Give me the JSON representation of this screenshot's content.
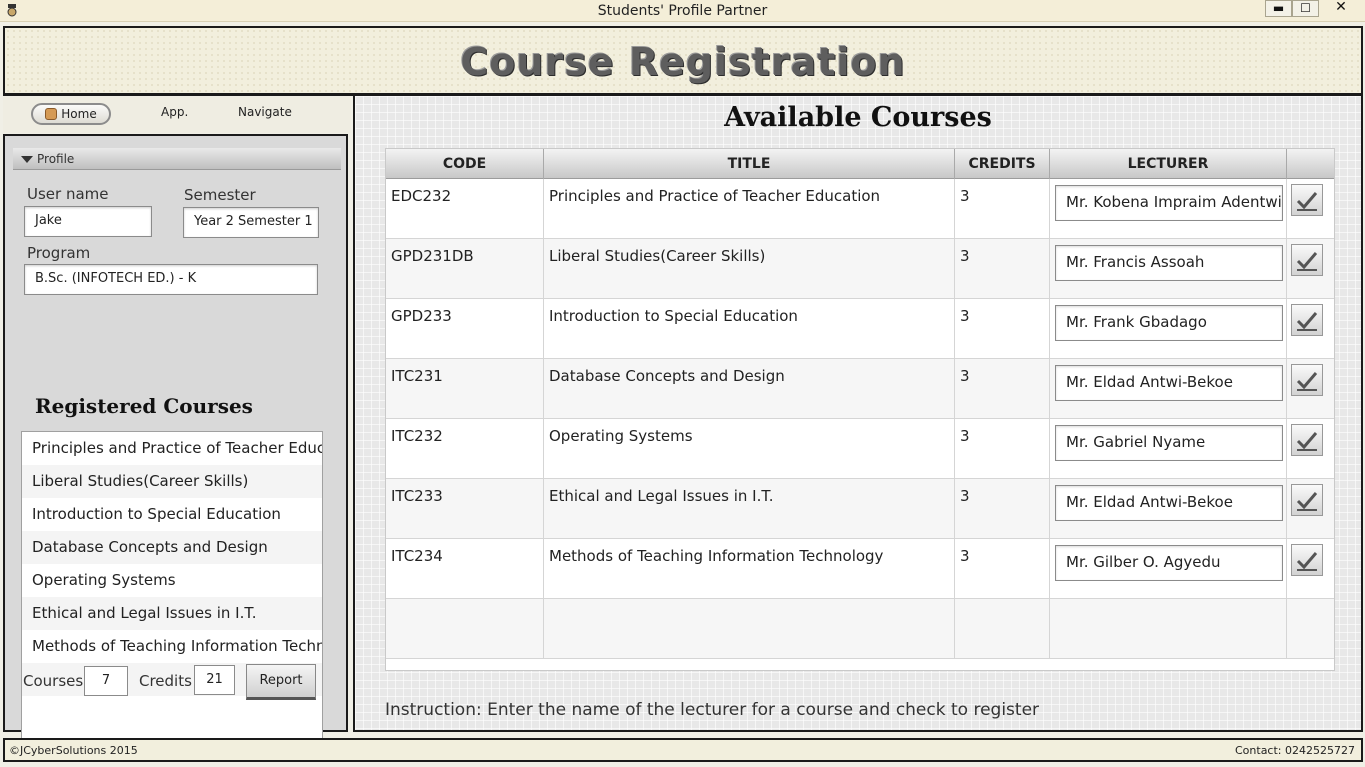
{
  "window": {
    "title": "Students' Profile Partner",
    "min": "▬",
    "max": "☐",
    "close": "✕"
  },
  "header": {
    "title": "Course Registration"
  },
  "nav": {
    "home": "Home",
    "app": "App.",
    "navigate": "Navigate"
  },
  "profile": {
    "section_label": "Profile",
    "username_label": "User name",
    "username": "Jake",
    "semester_label": "Semester",
    "semester": "Year 2 Semester 1",
    "program_label": "Program",
    "program": "B.Sc. (INFOTECH ED.) - K",
    "registered_title": "Registered Courses",
    "registered": [
      "Principles and Practice of Teacher Education",
      "Liberal Studies(Career Skills)",
      "Introduction to Special Education",
      "Database Concepts and Design",
      "Operating Systems",
      "Ethical and Legal Issues in I.T.",
      "Methods of Teaching Information Technology",
      ""
    ],
    "courses_label": "Courses",
    "courses": "7",
    "credits_label": "Credits",
    "credits": "21",
    "report_label": "Report"
  },
  "available": {
    "title": "Available Courses",
    "columns": {
      "code": "CODE",
      "title": "TITLE",
      "credits": "CREDITS",
      "lecturer": "LECTURER"
    },
    "rows": [
      {
        "code": "EDC232",
        "title": "Principles and Practice of Teacher Education",
        "credits": "3",
        "lecturer": "Mr. Kobena Impraim Adentwi"
      },
      {
        "code": "GPD231DB",
        "title": "Liberal Studies(Career Skills)",
        "credits": "3",
        "lecturer": "Mr. Francis Assoah"
      },
      {
        "code": "GPD233",
        "title": "Introduction to Special Education",
        "credits": "3",
        "lecturer": "Mr. Frank Gbadago"
      },
      {
        "code": "ITC231",
        "title": "Database Concepts and Design",
        "credits": "3",
        "lecturer": "Mr. Eldad Antwi-Bekoe"
      },
      {
        "code": "ITC232",
        "title": "Operating Systems",
        "credits": "3",
        "lecturer": "Mr. Gabriel Nyame"
      },
      {
        "code": "ITC233",
        "title": "Ethical and Legal Issues in I.T.",
        "credits": "3",
        "lecturer": "Mr. Eldad Antwi-Bekoe"
      },
      {
        "code": "ITC234",
        "title": "Methods of Teaching Information Technology",
        "credits": "3",
        "lecturer": "Mr. Gilber O. Agyedu"
      }
    ],
    "instruction": "Instruction: Enter the name of the lecturer for a course and  check to register"
  },
  "footer": {
    "copyright": "©JCyberSolutions 2015",
    "contact": "Contact: 0242525727"
  }
}
